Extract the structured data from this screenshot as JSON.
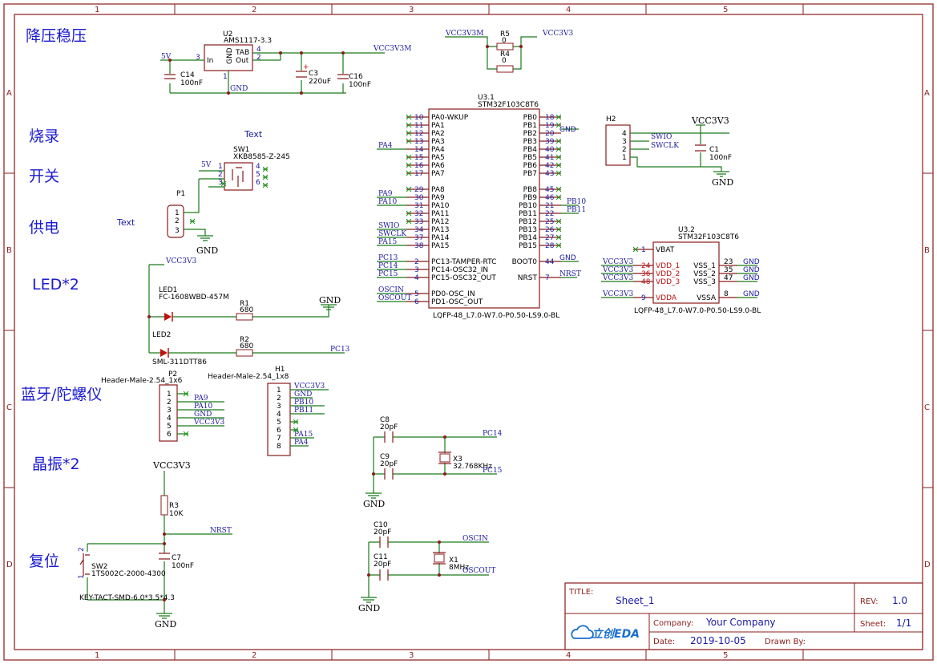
{
  "sections": {
    "step_down": "降压稳压",
    "program": "烧录",
    "switch": "开关",
    "power": "供电",
    "led": "LED*2",
    "bt_gyro": "蓝牙/陀螺仪",
    "crystal": "晶振*2",
    "reset": "复位"
  },
  "grid": {
    "cols": [
      "1",
      "2",
      "3",
      "4",
      "5"
    ],
    "rows": [
      "A",
      "B",
      "C",
      "D"
    ]
  },
  "u2": {
    "ref": "U2",
    "part": "AMS1117-3.3",
    "pin_in": "In",
    "pin_gnd": "GND",
    "pin_tab": "TAB",
    "pin_out": "Out",
    "n3": "3",
    "n4": "4",
    "n2": "2",
    "n1": "1"
  },
  "cap_c14": {
    "ref": "C14",
    "val": "100nF"
  },
  "cap_c3": {
    "ref": "C3",
    "val": "220uF",
    "pol": "+"
  },
  "cap_c16": {
    "ref": "C16",
    "val": "100nF"
  },
  "cap_c1": {
    "ref": "C1",
    "val": "100nF"
  },
  "cap_c7": {
    "ref": "C7",
    "val": "100nF"
  },
  "cap_c8": {
    "ref": "C8",
    "val": "20pF"
  },
  "cap_c9": {
    "ref": "C9",
    "val": "20pF"
  },
  "cap_c10": {
    "ref": "C10",
    "val": "20pF"
  },
  "cap_c11": {
    "ref": "C11",
    "val": "20pF"
  },
  "r5": {
    "ref": "R5",
    "val": "0"
  },
  "r4": {
    "ref": "R4",
    "val": "0"
  },
  "r1": {
    "ref": "R1",
    "val": "680"
  },
  "r2": {
    "ref": "R2",
    "val": "680"
  },
  "r3": {
    "ref": "R3",
    "val": "10K"
  },
  "led1": {
    "ref": "LED1",
    "part": "FC-1608WBD-457M"
  },
  "led2": {
    "ref": "LED2",
    "part": "SML-311DTT86"
  },
  "sw1": {
    "ref": "SW1",
    "part": "XKB8585-Z-245",
    "text": "Text",
    "pins": [
      "1",
      "2",
      "3",
      "4",
      "5",
      "6"
    ]
  },
  "sw2": {
    "ref": "SW2",
    "part": "1TS002C-2000-4300",
    "pkg": "KEY-TACT-SMD-6.0*3.5*4.3",
    "n1": "1",
    "n2": "2"
  },
  "p1": {
    "ref": "P1",
    "text": "Text",
    "pins": [
      "1",
      "2",
      "3"
    ]
  },
  "p2": {
    "ref": "P2",
    "pkg": "Header-Male-2.54_1x6",
    "pins": [
      "1",
      "2",
      "3",
      "4",
      "5",
      "6"
    ]
  },
  "h1": {
    "ref": "H1",
    "pkg": "Header-Male-2.54_1x8",
    "pins": [
      "1",
      "2",
      "3",
      "4",
      "5",
      "6",
      "7",
      "8"
    ]
  },
  "h2": {
    "ref": "H2",
    "pins": [
      "4",
      "3",
      "2",
      "1"
    ]
  },
  "x3": {
    "ref": "X3",
    "val": "32.768KHz"
  },
  "x1": {
    "ref": "X1",
    "val": "8MHz"
  },
  "u3_1": {
    "ref": "U3.1",
    "part": "STM32F103C8T6",
    "pkg": "LQFP-48_L7.0-W7.0-P0.50-LS9.0-BL",
    "left": [
      [
        "10",
        "PA0-WKUP"
      ],
      [
        "11",
        "PA1"
      ],
      [
        "12",
        "PA2"
      ],
      [
        "13",
        "PA3"
      ],
      [
        "14",
        "PA4"
      ],
      [
        "15",
        "PA5"
      ],
      [
        "16",
        "PA6"
      ],
      [
        "17",
        "PA7"
      ],
      [
        "29",
        "PA8"
      ],
      [
        "30",
        "PA9"
      ],
      [
        "31",
        "PA10"
      ],
      [
        "32",
        "PA11"
      ],
      [
        "33",
        "PA12"
      ],
      [
        "34",
        "PA13"
      ],
      [
        "37",
        "PA14"
      ],
      [
        "38",
        "PA15"
      ],
      [
        "2",
        "PC13-TAMPER-RTC"
      ],
      [
        "3",
        "PC14-OSC32_IN"
      ],
      [
        "4",
        "PC15-OSC32_OUT"
      ],
      [
        "5",
        "PD0-OSC_IN"
      ],
      [
        "6",
        "PD1-OSC_OUT"
      ]
    ],
    "right": [
      [
        "18",
        "PB0"
      ],
      [
        "19",
        "PB1"
      ],
      [
        "20",
        "PB2"
      ],
      [
        "39",
        "PB3"
      ],
      [
        "40",
        "PB4"
      ],
      [
        "41",
        "PB5"
      ],
      [
        "42",
        "PB6"
      ],
      [
        "43",
        "PB7"
      ],
      [
        "45",
        "PB8"
      ],
      [
        "46",
        "PB9"
      ],
      [
        "21",
        "PB10"
      ],
      [
        "22",
        "PB11"
      ],
      [
        "25",
        "PB12"
      ],
      [
        "26",
        "PB13"
      ],
      [
        "27",
        "PB14"
      ],
      [
        "28",
        "PB15"
      ],
      [
        "44",
        "BOOT0"
      ],
      [
        "7",
        "NRST"
      ]
    ]
  },
  "u3_2": {
    "ref": "U3.2",
    "part": "STM32F103C8T6",
    "pkg": "LQFP-48_L7.0-W7.0-P0.50-LS9.0-BL",
    "left": [
      [
        "1",
        "VBAT"
      ],
      [
        "24",
        "VDD_1"
      ],
      [
        "36",
        "VDD_2"
      ],
      [
        "48",
        "VDD_3"
      ],
      [
        "9",
        "VDDA"
      ]
    ],
    "right": [
      [
        "23",
        "VSS_1"
      ],
      [
        "35",
        "VSS_2"
      ],
      [
        "47",
        "VSS_3"
      ],
      [
        "8",
        "VSSA"
      ]
    ]
  },
  "nets": {
    "v5": "5V",
    "vcc3v3m": "VCC3V3M",
    "vcc3v3": "VCC3V3",
    "gnd": "GND",
    "pa4": "PA4",
    "pa9": "PA9",
    "pa10": "PA10",
    "swio": "SWIO",
    "swclk": "SWCLK",
    "pa15": "PA15",
    "pc13": "PC13",
    "pc14": "PC14",
    "pc15": "PC15",
    "oscin": "OSCIN",
    "oscout": "OSCOUT",
    "pb10": "PB10",
    "pb11": "PB11",
    "nrst": "NRST",
    "pb10b": "PB10",
    "pb11b": "PB11"
  },
  "title_block": {
    "title_label": "TITLE:",
    "title": "Sheet_1",
    "rev_label": "REV:",
    "rev": "1.0",
    "company_label": "Company:",
    "company": "Your Company",
    "sheet_label": "Sheet:",
    "sheet": "1/1",
    "date_label": "Date:",
    "date": "2019-10-05",
    "drawn_label": "Drawn By:",
    "logo": "立创EDA"
  }
}
